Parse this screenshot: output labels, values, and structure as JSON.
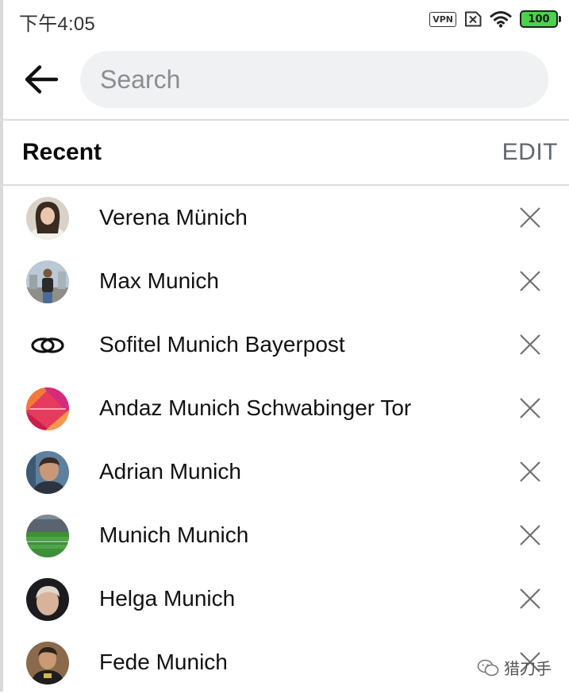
{
  "status_bar": {
    "time": "下午4:05",
    "vpn_label": "VPN",
    "battery_level": "100",
    "icons": [
      "vpn-icon",
      "no-sim-icon",
      "wifi-icon",
      "battery-icon"
    ]
  },
  "header": {
    "back_icon": "arrow-left-icon",
    "search_placeholder": "Search",
    "search_value": ""
  },
  "recent": {
    "title": "Recent",
    "edit_label": "EDIT",
    "items": [
      {
        "name": "Verena Münich",
        "avatar": "person-photo"
      },
      {
        "name": "Max Munich",
        "avatar": "person-photo"
      },
      {
        "name": "Sofitel Munich Bayerpost",
        "avatar": "sofitel-logo"
      },
      {
        "name": "Andaz Munich Schwabinger Tor",
        "avatar": "andaz-logo"
      },
      {
        "name": "Adrian Munich",
        "avatar": "person-photo"
      },
      {
        "name": "Munich Munich",
        "avatar": "stadium-photo"
      },
      {
        "name": "Helga Munich",
        "avatar": "person-photo"
      },
      {
        "name": "Fede Munich",
        "avatar": "person-photo"
      }
    ],
    "remove_icon": "close-icon"
  },
  "watermark": {
    "text": "猎刀手",
    "icon": "wechat-icon"
  },
  "colors": {
    "search_bg": "#f0f1f3",
    "placeholder": "#8a8d91",
    "edit": "#606770",
    "battery": "#4bd34b"
  }
}
